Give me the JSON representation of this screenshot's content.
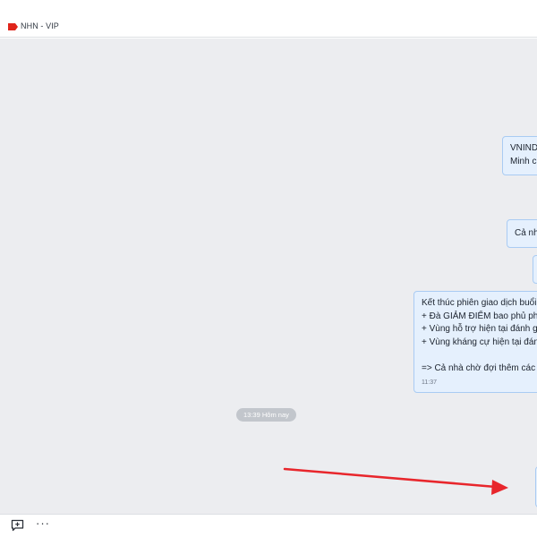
{
  "header": {
    "chat_name": "NHN - VIP",
    "tag_color": "#e0251b"
  },
  "messages": {
    "m1": {
      "line1": "VNINDE",
      "line2": "Minh cu"
    },
    "m2": {
      "line1": "Cả nhà"
    },
    "m4": {
      "line1": "Kết thúc phiên giao dịch buổi s",
      "line2": "+ Đà GIẢM ĐIỂM bao phủ phần",
      "line3": "+ Vùng hỗ trợ hiện tại đánh giá",
      "line4": "+ Vùng kháng cự hiện tại đánh",
      "line5": "=> Cả nhà chờ đợi thêm các vù",
      "time": "11:37"
    }
  },
  "separator": {
    "label": "13:39 Hôm nay"
  },
  "annotation": {
    "color": "#e8262c"
  },
  "bottom_toolbar": {
    "sticker_icon": "sticker-icon",
    "more_label": "···"
  }
}
